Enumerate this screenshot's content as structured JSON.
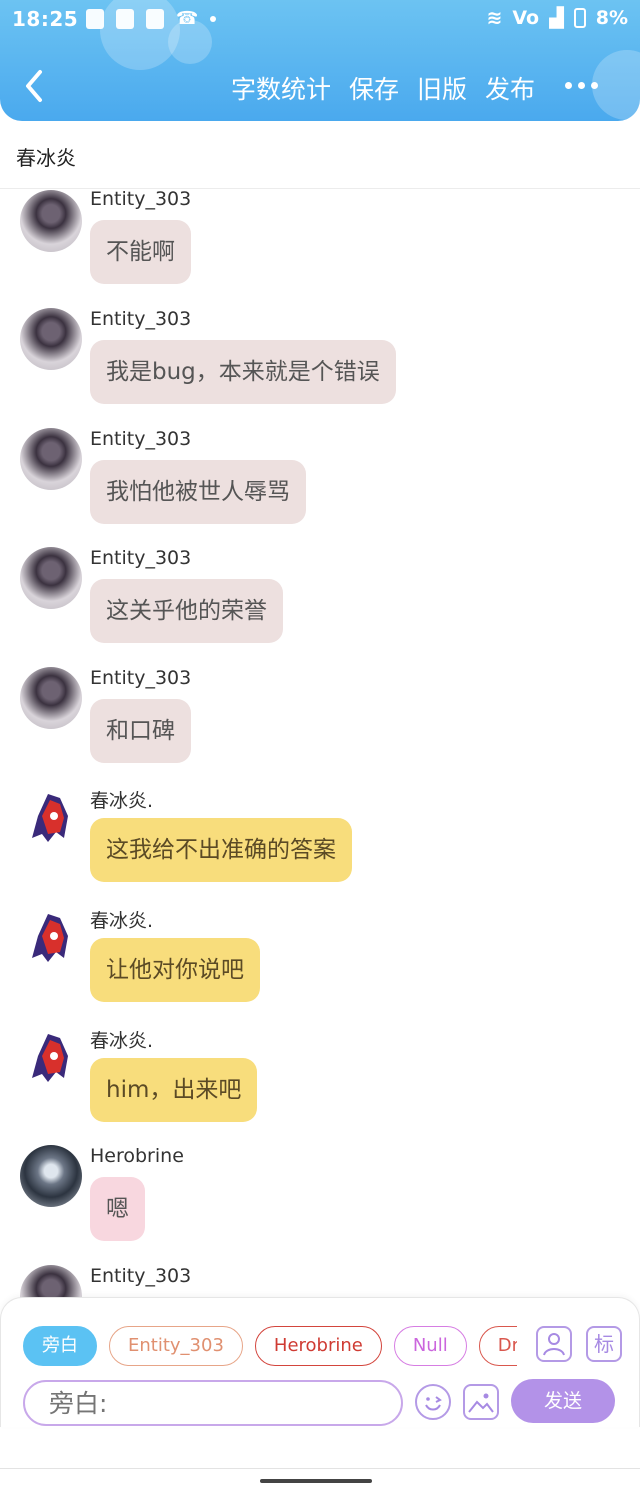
{
  "statusbar": {
    "time": "18:25",
    "network": "Vo",
    "battery": "8%"
  },
  "toolbar": {
    "word_count": "字数统计",
    "save": "保存",
    "old_version": "旧版",
    "publish": "发布"
  },
  "story": {
    "title": "春冰炎"
  },
  "messages": [
    {
      "sender": "Entity_303",
      "text": "不能啊"
    },
    {
      "sender": "Entity_303",
      "text": "我是bug，本来就是个错误"
    },
    {
      "sender": "Entity_303",
      "text": "我怕他被世人辱骂"
    },
    {
      "sender": "Entity_303",
      "text": "这关乎他的荣誉"
    },
    {
      "sender": "Entity_303",
      "text": "和口碑"
    },
    {
      "sender": "春冰炎.",
      "text": "这我给不出准确的答案"
    },
    {
      "sender": "春冰炎.",
      "text": "让他对你说吧"
    },
    {
      "sender": "春冰炎.",
      "text": "him，出来吧"
    },
    {
      "sender": "Herobrine",
      "text": "嗯"
    },
    {
      "sender": "Entity_303",
      "text": ""
    }
  ],
  "composer": {
    "characters": [
      "旁白",
      "Entity_303",
      "Herobrine",
      "Null",
      "Drea"
    ],
    "tag_button": "标",
    "input_placeholder": "旁白:",
    "send": "发送"
  },
  "colors": {
    "header": "#4aa9ee",
    "bubble_entity": "#ede0df",
    "bubble_chun": "#f8dd7c",
    "bubble_herobrine": "#f8d7df",
    "send_button": "#b392e8"
  }
}
